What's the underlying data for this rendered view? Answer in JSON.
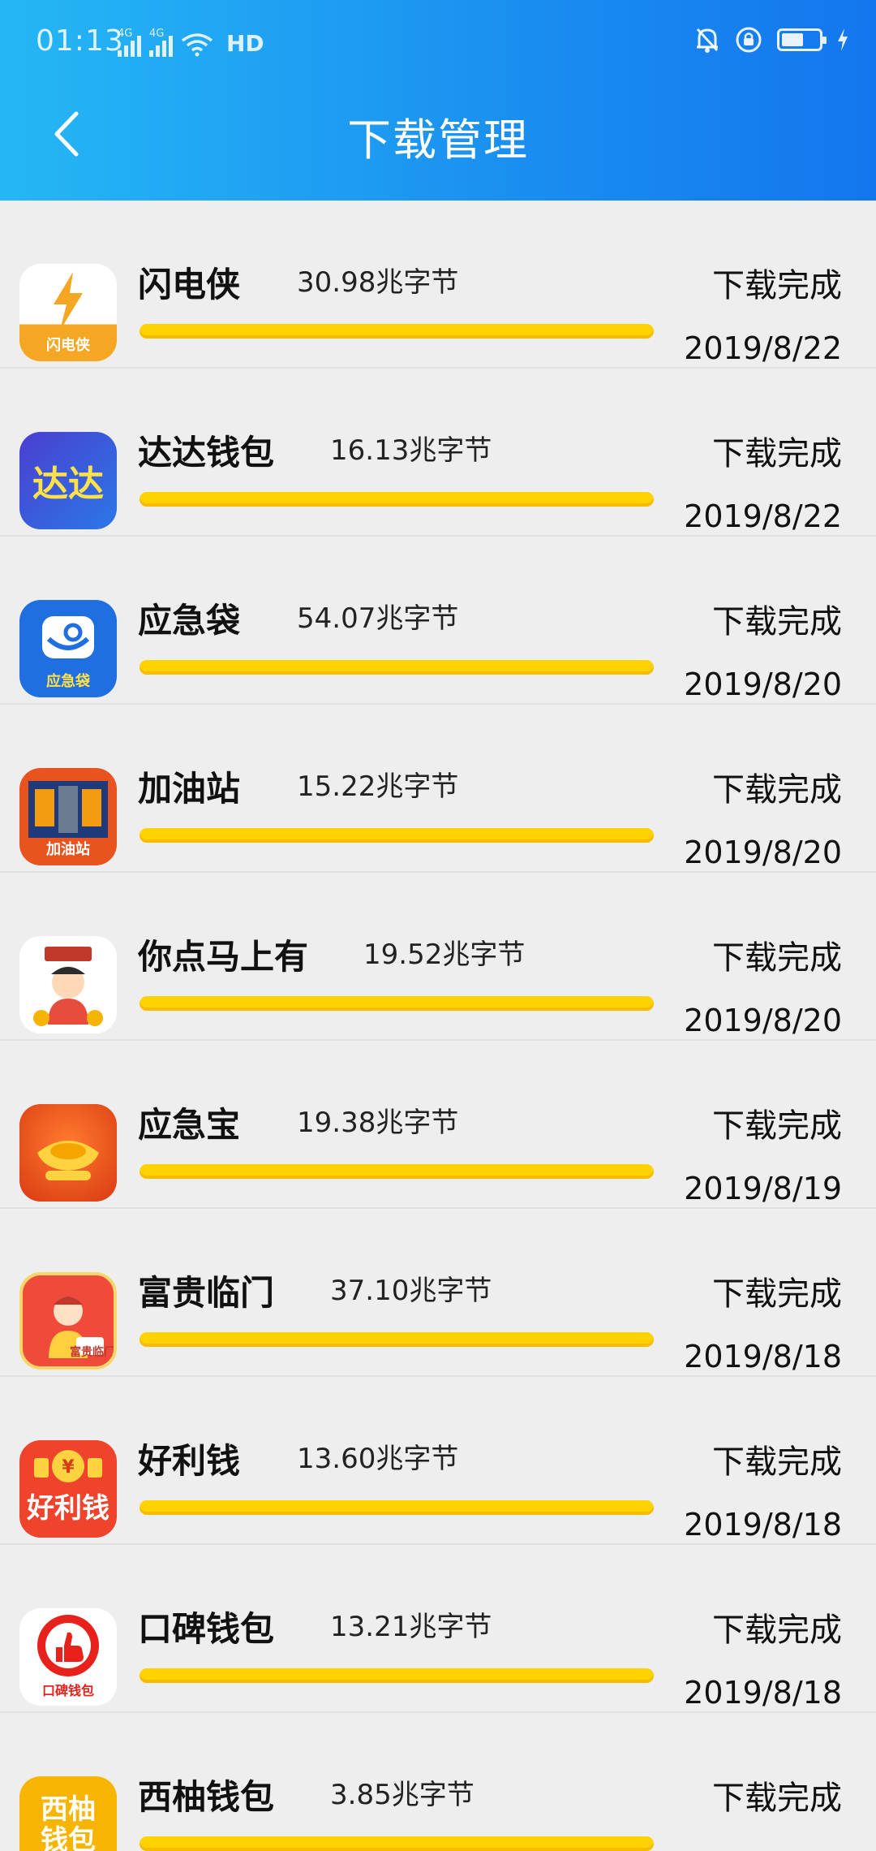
{
  "status_bar": {
    "time": "01:13",
    "network_1": "4G",
    "network_2": "4G",
    "hd": "HD"
  },
  "header": {
    "title": "下载管理",
    "back_icon": "chevron-left-icon",
    "background_colors": [
      "#25b7f5",
      "#1376ee"
    ]
  },
  "downloads": [
    {
      "name": "闪电侠",
      "size": "30.98兆字节",
      "status": "下载完成",
      "date": "2019/8/22",
      "icon": "flash-hero-icon",
      "icon_caption": "闪电侠",
      "icon_bg": "#f7b42c",
      "progress": 1.0
    },
    {
      "name": "达达钱包",
      "size": "16.13兆字节",
      "status": "下载完成",
      "date": "2019/8/22",
      "icon": "dada-wallet-icon",
      "icon_caption": "达达",
      "icon_bg": "#3557d6",
      "progress": 1.0
    },
    {
      "name": "应急袋",
      "size": "54.07兆字节",
      "status": "下载完成",
      "date": "2019/8/20",
      "icon": "emergency-bag-icon",
      "icon_caption": "应急袋",
      "icon_bg": "#1f6fe0",
      "progress": 1.0
    },
    {
      "name": "加油站",
      "size": "15.22兆字节",
      "status": "下载完成",
      "date": "2019/8/20",
      "icon": "gas-station-icon",
      "icon_caption": "加油站",
      "icon_bg": "#e8531e",
      "progress": 1.0
    },
    {
      "name": "你点马上有",
      "size": "19.52兆字节",
      "status": "下载完成",
      "date": "2019/8/20",
      "icon": "fortune-god-icon",
      "icon_caption": "",
      "icon_bg": "#ffffff",
      "progress": 1.0
    },
    {
      "name": "应急宝",
      "size": "19.38兆字节",
      "status": "下载完成",
      "date": "2019/8/19",
      "icon": "gold-ingot-icon",
      "icon_caption": "",
      "icon_bg": "#e8461c",
      "progress": 1.0
    },
    {
      "name": "富贵临门",
      "size": "37.10兆字节",
      "status": "下载完成",
      "date": "2019/8/18",
      "icon": "wealth-god-icon",
      "icon_caption": "富贵临门",
      "icon_bg": "#f04a3a",
      "progress": 1.0
    },
    {
      "name": "好利钱",
      "size": "13.60兆字节",
      "status": "下载完成",
      "date": "2019/8/18",
      "icon": "good-profit-money-icon",
      "icon_caption": "好利钱",
      "icon_bg": "#f0432c",
      "progress": 1.0
    },
    {
      "name": "口碑钱包",
      "size": "13.21兆字节",
      "status": "下载完成",
      "date": "2019/8/18",
      "icon": "thumbs-up-icon",
      "icon_caption": "口碑钱包",
      "icon_bg": "#ffffff",
      "progress": 1.0
    },
    {
      "name": "西柚钱包",
      "size": "3.85兆字节",
      "status": "下载完成",
      "date": "",
      "icon": "grapefruit-wallet-icon",
      "icon_caption": "西柚钱包",
      "icon_bg": "#f7b400",
      "progress": 1.0
    }
  ],
  "colors": {
    "progress": "#ffd200",
    "background": "#eeeeee"
  }
}
